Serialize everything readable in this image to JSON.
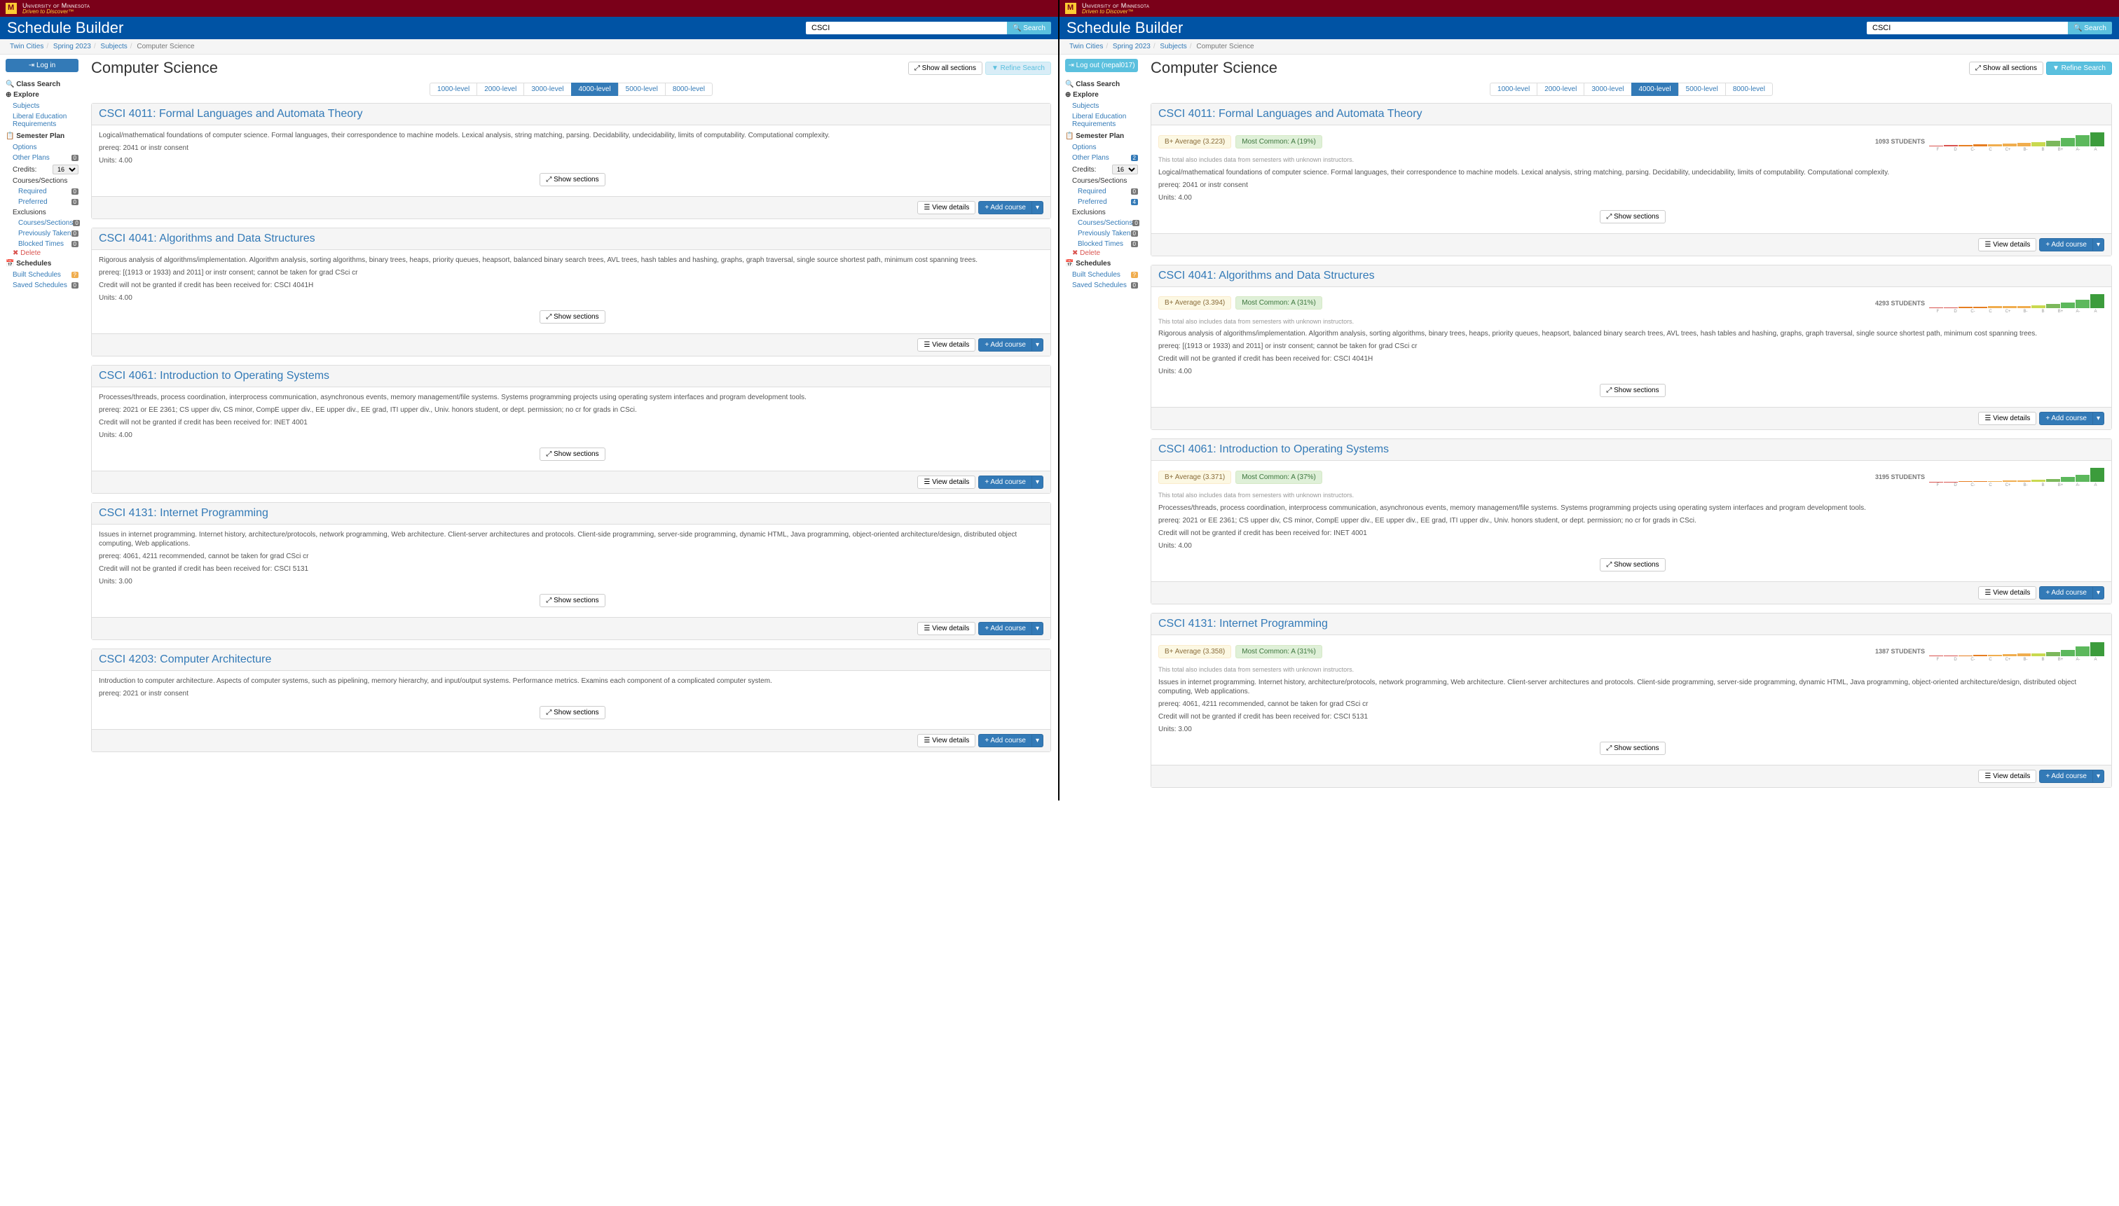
{
  "umn": {
    "name": "University of Minnesota",
    "tagline": "Driven to Discover™"
  },
  "appTitle": "Schedule Builder",
  "search": {
    "value": "CSCI",
    "button": "Search"
  },
  "breadcrumbs": {
    "a": "Twin Cities",
    "b": "Spring 2023",
    "c": "Subjects",
    "d": "Computer Science"
  },
  "loginLabel": "Log in",
  "logoutLabel": "Log out (nepal017)",
  "sidebar": {
    "classSearch": "Class Search",
    "explore": "Explore",
    "subjects": "Subjects",
    "libEd": "Liberal Education Requirements",
    "semPlan": "Semester Plan",
    "options": "Options",
    "otherPlans": "Other Plans",
    "credits": "Credits:",
    "creditsVal": "16",
    "coursesSections": "Courses/Sections",
    "required": "Required",
    "preferred": "Preferred",
    "exclusions": "Exclusions",
    "exCourses": "Courses/Sections",
    "prevTaken": "Previously Taken",
    "blockedTimes": "Blocked Times",
    "delete": "Delete",
    "schedules": "Schedules",
    "builtSchedules": "Built Schedules",
    "savedSchedules": "Saved Schedules"
  },
  "leftCounts": {
    "otherPlans": "0",
    "required": "0",
    "preferred": "0",
    "exCourses": "0",
    "prevTaken": "0",
    "blockedTimes": "0",
    "built": "?",
    "saved": "0"
  },
  "rightCounts": {
    "otherPlans": "2",
    "required": "0",
    "preferred": "4",
    "exCourses": "0",
    "prevTaken": "0",
    "blockedTimes": "0",
    "built": "?",
    "saved": "0"
  },
  "pageTitle": "Computer Science",
  "showAll": "Show all sections",
  "refine": "Refine Search",
  "levels": [
    "1000-level",
    "2000-level",
    "3000-level",
    "4000-level",
    "5000-level",
    "8000-level"
  ],
  "activeLevel": "4000-level",
  "viewDetails": "View details",
  "addCourse": "Add course",
  "showSections": "Show sections",
  "noteUnknown": "This total also includes data from semesters with unknown instructors.",
  "gradeLetters": [
    "F",
    "D",
    "C-",
    "C",
    "C+",
    "B-",
    "B",
    "B+",
    "A-",
    "A"
  ],
  "courses": [
    {
      "title": "CSCI 4011: Formal Languages and Automata Theory",
      "desc": "Logical/mathematical foundations of computer science. Formal languages, their correspondence to machine models. Lexical analysis, string matching, parsing. Decidability, undecidability, limits of computability. Computational complexity.",
      "prereq": "prereq: 2041 or instr consent",
      "credit": "",
      "units": "Units: 4.00",
      "avg": "B+ Average (3.223)",
      "common": "Most Common: A (19%)",
      "students": "1093 STUDENTS",
      "spark": [
        1,
        2,
        2,
        3,
        3,
        4,
        5,
        6,
        8,
        12,
        16,
        20
      ]
    },
    {
      "title": "CSCI 4041: Algorithms and Data Structures",
      "desc": "Rigorous analysis of algorithms/implementation. Algorithm analysis, sorting algorithms, binary trees, heaps, priority queues, heapsort, balanced binary search trees, AVL trees, hash tables and hashing, graphs, graph traversal, single source shortest path, minimum cost spanning trees.",
      "prereq": "prereq: [(1913 or 1933) and 2011] or instr consent; cannot be taken for grad CSci cr",
      "credit": "Credit will not be granted if credit has been received for: CSCI 4041H",
      "units": "Units: 4.00",
      "avg": "B+ Average (3.394)",
      "common": "Most Common: A (31%)",
      "students": "4293 STUDENTS",
      "spark": [
        1,
        1,
        2,
        2,
        3,
        3,
        4,
        5,
        7,
        10,
        15,
        25
      ]
    },
    {
      "title": "CSCI 4061: Introduction to Operating Systems",
      "desc": "Processes/threads, process coordination, interprocess communication, asynchronous events, memory management/file systems. Systems programming projects using operating system interfaces and program development tools.",
      "prereq": "prereq: 2021 or EE 2361; CS upper div, CS minor, CompE upper div., EE upper div., EE grad, ITI upper div., Univ. honors student, or dept. permission; no cr for grads in CSci.",
      "credit": "Credit will not be granted if credit has been received for: INET 4001",
      "units": "Units: 4.00",
      "avg": "B+ Average (3.371)",
      "common": "Most Common: A (37%)",
      "students": "3195 STUDENTS",
      "spark": [
        1,
        1,
        2,
        2,
        2,
        3,
        3,
        4,
        6,
        9,
        14,
        26
      ]
    },
    {
      "title": "CSCI 4131: Internet Programming",
      "desc": "Issues in internet programming. Internet history, architecture/protocols, network programming, Web architecture. Client-server architectures and protocols. Client-side programming, server-side programming, dynamic HTML, Java programming, object-oriented architecture/design, distributed object computing, Web applications.",
      "prereq": "prereq: 4061, 4211 recommended, cannot be taken for grad CSci cr",
      "credit": "Credit will not be granted if credit has been received for: CSCI 5131",
      "units": "Units: 3.00",
      "avg": "B+ Average (3.358)",
      "common": "Most Common: A (31%)",
      "students": "1387 STUDENTS",
      "spark": [
        1,
        1,
        1,
        2,
        2,
        3,
        4,
        5,
        7,
        10,
        15,
        22
      ]
    },
    {
      "title": "CSCI 4203: Computer Architecture",
      "desc": "Introduction to computer architecture. Aspects of computer systems, such as pipelining, memory hierarchy, and input/output systems. Performance metrics. Examins each component of a complicated computer system.",
      "prereq": "prereq: 2021 or instr consent",
      "credit": "",
      "units": "",
      "avg": "",
      "common": "",
      "students": "",
      "spark": []
    }
  ]
}
